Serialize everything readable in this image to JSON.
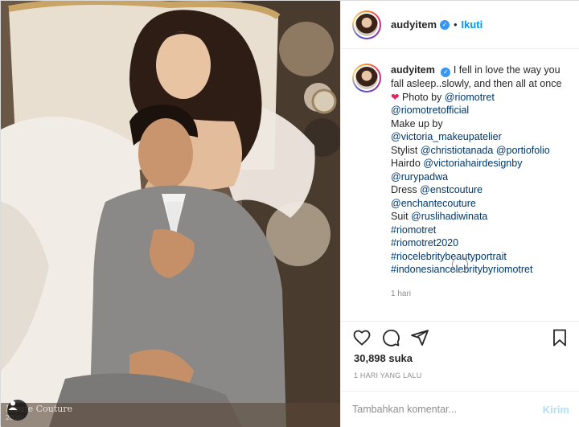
{
  "post": {
    "username": "audyitem",
    "follow_label": "Ikuti",
    "caption_parts": {
      "text1": "I fell in love the way you fall asleep..slowly, and then all at once",
      "text2": " Photo by ",
      "m1": "@riomotret",
      "m2": "@riomotretofficial",
      "text3": "Make up by",
      "m3": "@victoria_makeupatelier",
      "text4": "Stylist ",
      "m4": "@christiotanada",
      "m5": "@portiofolio",
      "text5": "Hairdo ",
      "m6": "@victoriahairdesignby",
      "m7": "@rurypadwa",
      "text6": "Dress ",
      "m8": "@enstcouture",
      "m9": "@enchantecouture",
      "text7": "Suit ",
      "m10": "@ruslihadiwinata",
      "h1": "#riomotret",
      "h2": "#riomotret2020",
      "h3": "#riocelebritybeautyportrait",
      "h4": "#indonesiancelebritybyriomotret"
    },
    "caption_time": "1 hari",
    "likes": "30,898 suka",
    "posted_time": "1 HARI YANG LALU",
    "comment_placeholder": "Tambahkan komentar...",
    "post_label": "Kirim"
  },
  "photo": {
    "watermark_line1": "Haute Couture",
    "watermark_line2": "2020"
  },
  "colors": {
    "link": "#00376b",
    "accent": "#0095f6",
    "verified": "#3897f0",
    "heart": "#e0245e",
    "muted": "#8e8e8e"
  },
  "icons": [
    "verified-badge-icon",
    "heart-icon",
    "comment-icon",
    "share-icon",
    "bookmark-icon",
    "loading-icon",
    "profile-icon"
  ]
}
